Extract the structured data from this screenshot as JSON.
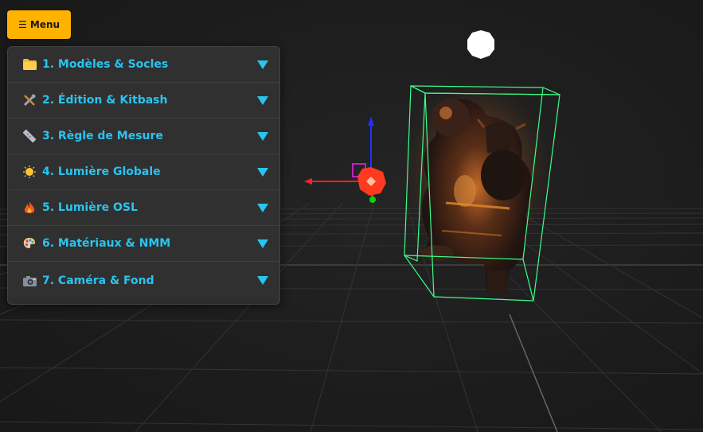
{
  "menu_button": {
    "icon": "hamburger-icon",
    "label": "☰ Menu"
  },
  "accordion": {
    "items": [
      {
        "label": "1. Modèles & Socles",
        "icon": "folder-icon"
      },
      {
        "label": "2. Édition & Kitbash",
        "icon": "tools-icon"
      },
      {
        "label": "3. Règle de Mesure",
        "icon": "ruler-icon"
      },
      {
        "label": "4. Lumière Globale",
        "icon": "sun-icon"
      },
      {
        "label": "5. Lumière OSL",
        "icon": "fire-icon"
      },
      {
        "label": "6. Matériaux & NMM",
        "icon": "palette-icon"
      },
      {
        "label": "7. Caméra & Fond",
        "icon": "camera-icon"
      }
    ],
    "accent_color": "#29c4f0"
  },
  "scene": {
    "grid_color": "#3a3a3a",
    "bounding_box_color": "#3dff8a",
    "gizmo_colors": {
      "x": "#ff2020",
      "y": "#2030ff",
      "z": "#10d010"
    },
    "light_color": "#ff3a20",
    "model_material": "dark metallic copper"
  },
  "colors": {
    "menu_button": "#ffb300",
    "panel_bg": "#2d2d2d"
  }
}
